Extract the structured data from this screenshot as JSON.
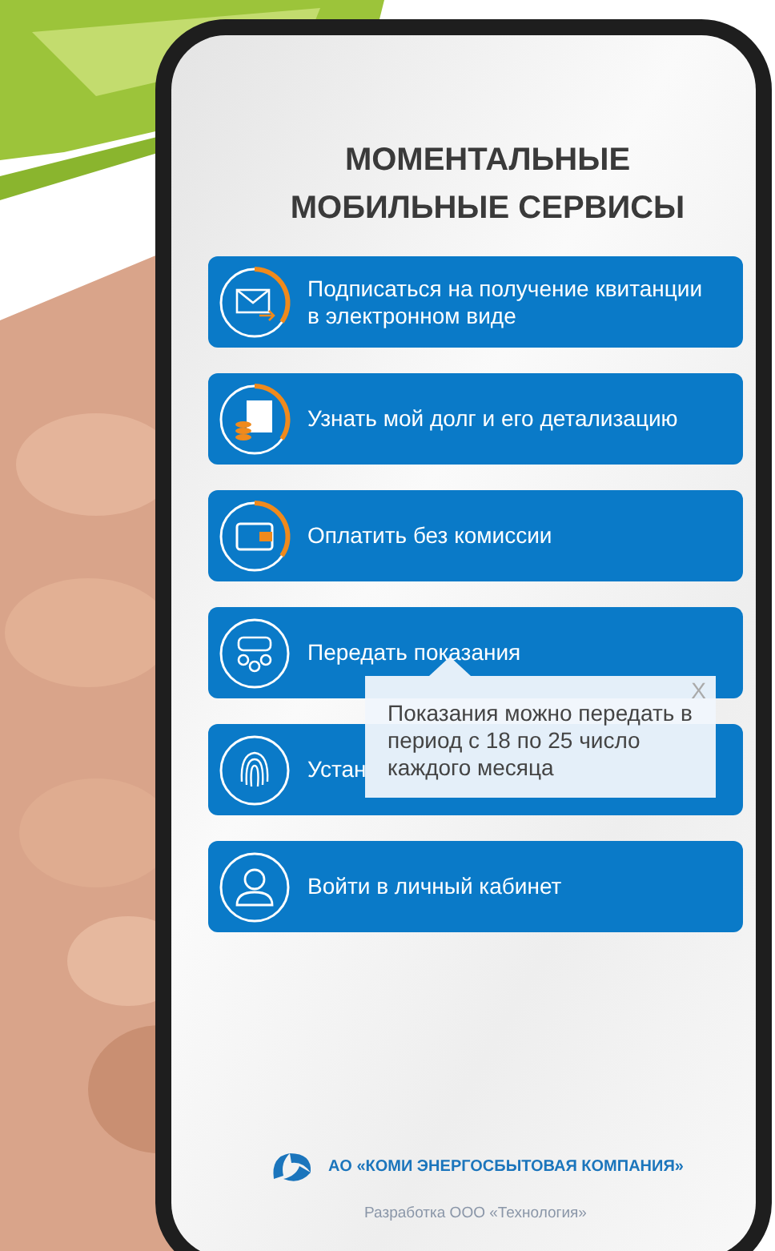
{
  "title": [
    "МОМЕНТАЛЬНЫЕ",
    "МОБИЛЬНЫЕ СЕРВИСЫ"
  ],
  "services": [
    {
      "label": "Подписаться на получение квитанции в электронном виде",
      "highlight": true
    },
    {
      "label": "Узнать мой долг и его детализацию",
      "highlight": true
    },
    {
      "label": "Оплатить без комиссии",
      "highlight": true
    },
    {
      "label": "Передать показания",
      "highlight": false
    },
    {
      "label": "Устан",
      "highlight": false
    },
    {
      "label": "Войти в личный кабинет",
      "highlight": false
    }
  ],
  "tooltip": {
    "text": "Показания можно передать в период с 18 по 25 число каждого месяца",
    "close": "X"
  },
  "company": "АО «КОМИ ЭНЕРГОСБЫТОВАЯ КОМПАНИЯ»",
  "developer": "Разработка ООО «Технология»"
}
